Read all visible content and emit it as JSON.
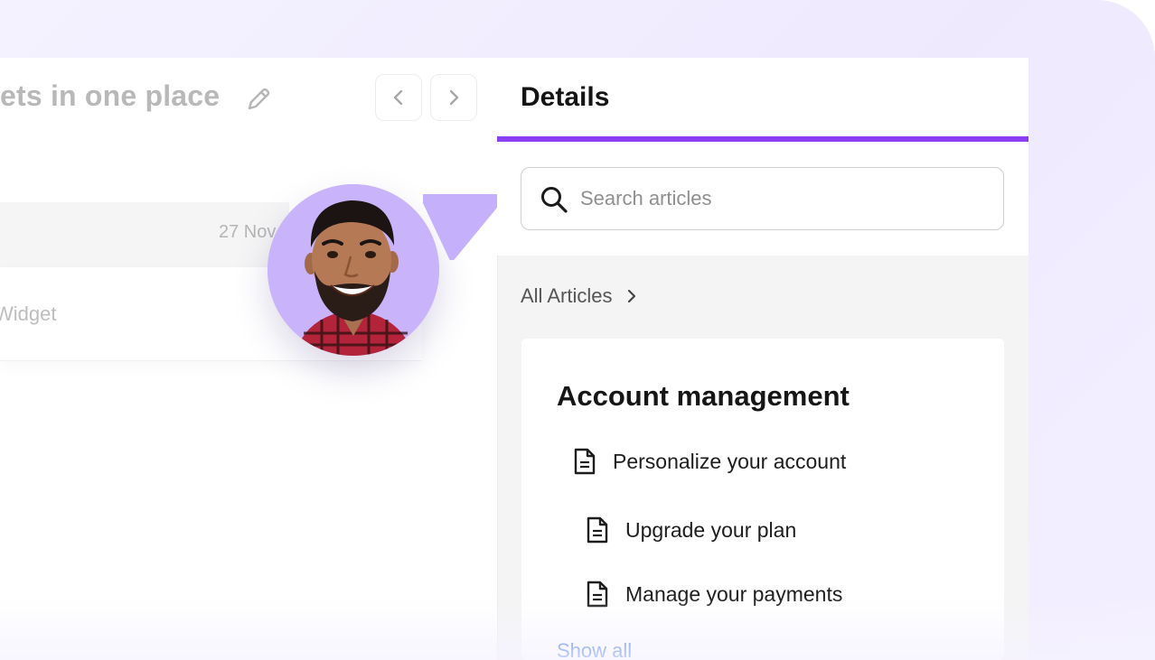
{
  "left": {
    "title": "ets in one place",
    "date": "27 Nov",
    "row_text": "Widget"
  },
  "right": {
    "title": "Details",
    "search": {
      "placeholder": "Search articles",
      "value": ""
    },
    "breadcrumb": "All Articles",
    "card": {
      "title": "Account management",
      "articles": [
        {
          "label": "Personalize your account"
        },
        {
          "label": "Upgrade your plan"
        },
        {
          "label": "Manage your payments"
        }
      ],
      "show_all": "Show all"
    }
  },
  "colors": {
    "accent": "#8b3ef2",
    "avatar_bg": "#c9b4fb",
    "pointer": "#c5b0fb",
    "link": "#2e6fe0"
  },
  "icons": [
    "pencil-icon",
    "chevron-left-icon",
    "chevron-right-icon",
    "search-icon",
    "chevron-right-icon",
    "document-icon"
  ]
}
